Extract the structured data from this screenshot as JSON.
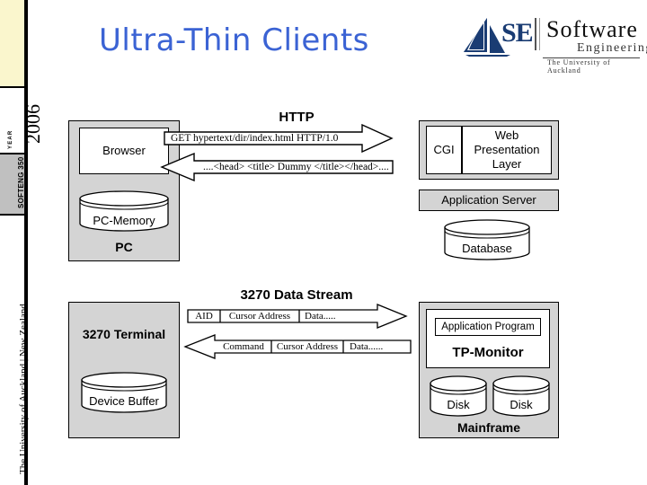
{
  "slide": {
    "title": "Ultra-Thin Clients"
  },
  "sidebar": {
    "year_number": "2006",
    "year_label": "YEAR",
    "course_code": "SOFTENG 350",
    "university": "The University of Auckland | New Zealand"
  },
  "logo": {
    "mark": "SE",
    "word_software": "Software",
    "word_engineering": "Engineering",
    "tagline": "The University of Auckland"
  },
  "top_section": {
    "client_box": {
      "caption": "PC",
      "app_label": "Browser",
      "storage_label": "PC-Memory"
    },
    "protocol_title": "HTTP",
    "request_text": "GET hypertext/dir/index.html HTTP/1.0",
    "response_text": "....<head> <title> Dummy </title></head>....",
    "server_box": {
      "cgi_label": "CGI",
      "web_layer_label": "Web Presentation Layer",
      "web_layer_line1": "Web",
      "web_layer_line2": "Presentation",
      "web_layer_line3": "Layer"
    },
    "app_server_label": "Application Server",
    "database_label": "Database"
  },
  "bottom_section": {
    "terminal_box": {
      "caption": "3270 Terminal",
      "storage_label": "Device Buffer"
    },
    "protocol_title": "3270 Data Stream",
    "inbound_cells": [
      "AID",
      "Cursor Address",
      "Data....."
    ],
    "outbound_cells": [
      "Command",
      "Cursor Address",
      "Data......"
    ],
    "mainframe_box": {
      "caption": "Mainframe",
      "app_program_label": "Application Program",
      "tp_monitor_label": "TP-Monitor",
      "disk1_label": "Disk",
      "disk2_label": "Disk"
    }
  },
  "colors": {
    "title_blue": "#3b63d4",
    "box_gray": "#d4d4d4",
    "cream": "#faf6cd",
    "course_gray": "#c0c0c0",
    "logo_navy": "#1a3c73"
  }
}
